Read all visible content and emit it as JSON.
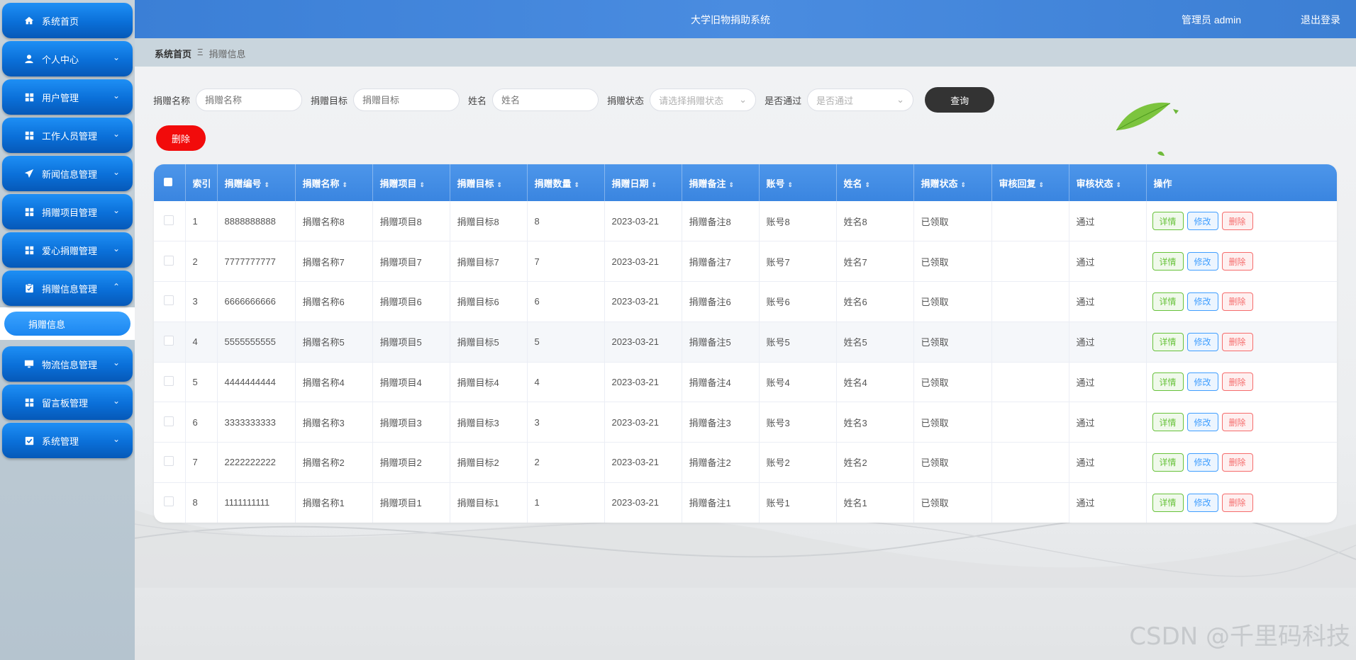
{
  "app": {
    "title": "大学旧物捐助系统",
    "user_text": "管理员 admin",
    "logout": "退出登录"
  },
  "sidebar": {
    "items": [
      {
        "label": "系统首页",
        "icon": "home-icon",
        "arrow": ""
      },
      {
        "label": "个人中心",
        "icon": "user-icon",
        "arrow": "⌄"
      },
      {
        "label": "用户管理",
        "icon": "grid-icon",
        "arrow": "⌄"
      },
      {
        "label": "工作人员管理",
        "icon": "grid-icon",
        "arrow": "⌄"
      },
      {
        "label": "新闻信息管理",
        "icon": "send-icon",
        "arrow": "⌄"
      },
      {
        "label": "捐赠项目管理",
        "icon": "grid-icon",
        "arrow": "⌄"
      },
      {
        "label": "爱心捐赠管理",
        "icon": "grid-icon",
        "arrow": "⌄"
      },
      {
        "label": "捐赠信息管理",
        "icon": "clipboard-icon",
        "arrow": "⌃"
      },
      {
        "label": "物流信息管理",
        "icon": "monitor-icon",
        "arrow": "⌄"
      },
      {
        "label": "留言板管理",
        "icon": "grid-icon",
        "arrow": "⌄"
      },
      {
        "label": "系统管理",
        "icon": "checkbox-icon",
        "arrow": "⌄"
      }
    ],
    "active_sub": "捐赠信息"
  },
  "breadcrumb": {
    "home": "系统首页",
    "sep": "Ξ",
    "current": "捐赠信息"
  },
  "search": {
    "name_label": "捐赠名称",
    "name_placeholder": "捐赠名称",
    "target_label": "捐赠目标",
    "target_placeholder": "捐赠目标",
    "person_label": "姓名",
    "person_placeholder": "姓名",
    "status_label": "捐赠状态",
    "status_placeholder": "请选择捐赠状态",
    "pass_label": "是否通过",
    "pass_placeholder": "是否通过",
    "query": "查询"
  },
  "toolbar": {
    "delete": "删除"
  },
  "table": {
    "columns": [
      "索引",
      "捐赠编号",
      "捐赠名称",
      "捐赠项目",
      "捐赠目标",
      "捐赠数量",
      "捐赠日期",
      "捐赠备注",
      "账号",
      "姓名",
      "捐赠状态",
      "审核回复",
      "审核状态",
      "操作"
    ],
    "actions": {
      "detail": "详情",
      "edit": "修改",
      "delete": "删除"
    },
    "rows": [
      [
        "1",
        "8888888888",
        "捐赠名称8",
        "捐赠项目8",
        "捐赠目标8",
        "8",
        "2023-03-21",
        "捐赠备注8",
        "账号8",
        "姓名8",
        "已领取",
        "",
        "通过"
      ],
      [
        "2",
        "7777777777",
        "捐赠名称7",
        "捐赠项目7",
        "捐赠目标7",
        "7",
        "2023-03-21",
        "捐赠备注7",
        "账号7",
        "姓名7",
        "已领取",
        "",
        "通过"
      ],
      [
        "3",
        "6666666666",
        "捐赠名称6",
        "捐赠项目6",
        "捐赠目标6",
        "6",
        "2023-03-21",
        "捐赠备注6",
        "账号6",
        "姓名6",
        "已领取",
        "",
        "通过"
      ],
      [
        "4",
        "5555555555",
        "捐赠名称5",
        "捐赠项目5",
        "捐赠目标5",
        "5",
        "2023-03-21",
        "捐赠备注5",
        "账号5",
        "姓名5",
        "已领取",
        "",
        "通过"
      ],
      [
        "5",
        "4444444444",
        "捐赠名称4",
        "捐赠项目4",
        "捐赠目标4",
        "4",
        "2023-03-21",
        "捐赠备注4",
        "账号4",
        "姓名4",
        "已领取",
        "",
        "通过"
      ],
      [
        "6",
        "3333333333",
        "捐赠名称3",
        "捐赠项目3",
        "捐赠目标3",
        "3",
        "2023-03-21",
        "捐赠备注3",
        "账号3",
        "姓名3",
        "已领取",
        "",
        "通过"
      ],
      [
        "7",
        "2222222222",
        "捐赠名称2",
        "捐赠项目2",
        "捐赠目标2",
        "2",
        "2023-03-21",
        "捐赠备注2",
        "账号2",
        "姓名2",
        "已领取",
        "",
        "通过"
      ],
      [
        "8",
        "1111111111",
        "捐赠名称1",
        "捐赠项目1",
        "捐赠目标1",
        "1",
        "2023-03-21",
        "捐赠备注1",
        "账号1",
        "姓名1",
        "已领取",
        "",
        "通过"
      ]
    ]
  },
  "watermark": "CSDN @千里码科技",
  "colors": {
    "header": "#3b7fd6",
    "sidebar_item": "#0a6fd8",
    "table_header": "#4d96ea",
    "delete_btn": "#f20b0b",
    "query_btn": "#333333"
  }
}
